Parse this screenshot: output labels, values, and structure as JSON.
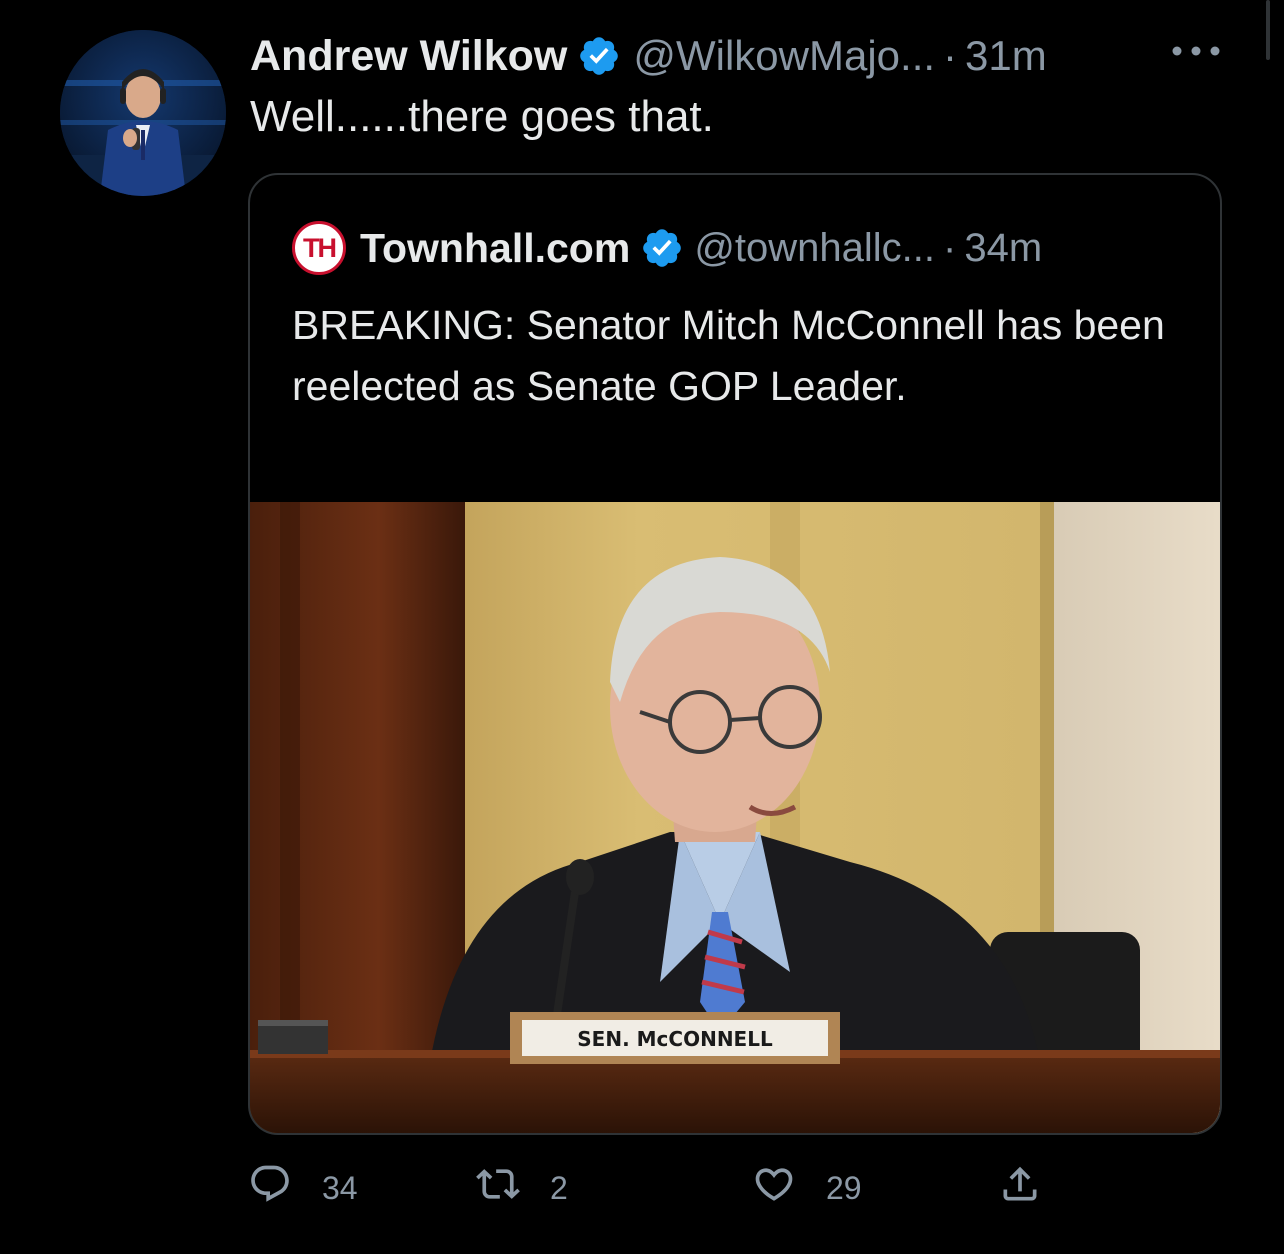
{
  "tweet": {
    "display_name": "Andrew Wilkow",
    "handle": "@WilkowMajo...",
    "separator": "·",
    "time": "31m",
    "text": "Well......there goes that.",
    "more_icon": "more-horizontal-icon",
    "verified_icon": "verified-badge-icon"
  },
  "quoted": {
    "logo_text": "TH",
    "display_name": "Townhall.com",
    "handle": "@townhallc...",
    "separator": "·",
    "time": "34m",
    "text": "BREAKING: Senator Mitch McConnell has been reelected as Senate GOP Leader.",
    "image": {
      "nameplate_text": "SEN. McCONNELL"
    }
  },
  "actions": {
    "reply": {
      "icon": "reply-icon",
      "count": "34"
    },
    "retweet": {
      "icon": "retweet-icon",
      "count": "2"
    },
    "like": {
      "icon": "heart-icon",
      "count": "29"
    },
    "share": {
      "icon": "share-icon"
    }
  },
  "colors": {
    "background": "#000000",
    "text_primary": "#e7e9ea",
    "text_secondary": "#8b98a5",
    "verified": "#1d9bf0",
    "border": "#2f3336",
    "townhall_red": "#c8102e"
  }
}
